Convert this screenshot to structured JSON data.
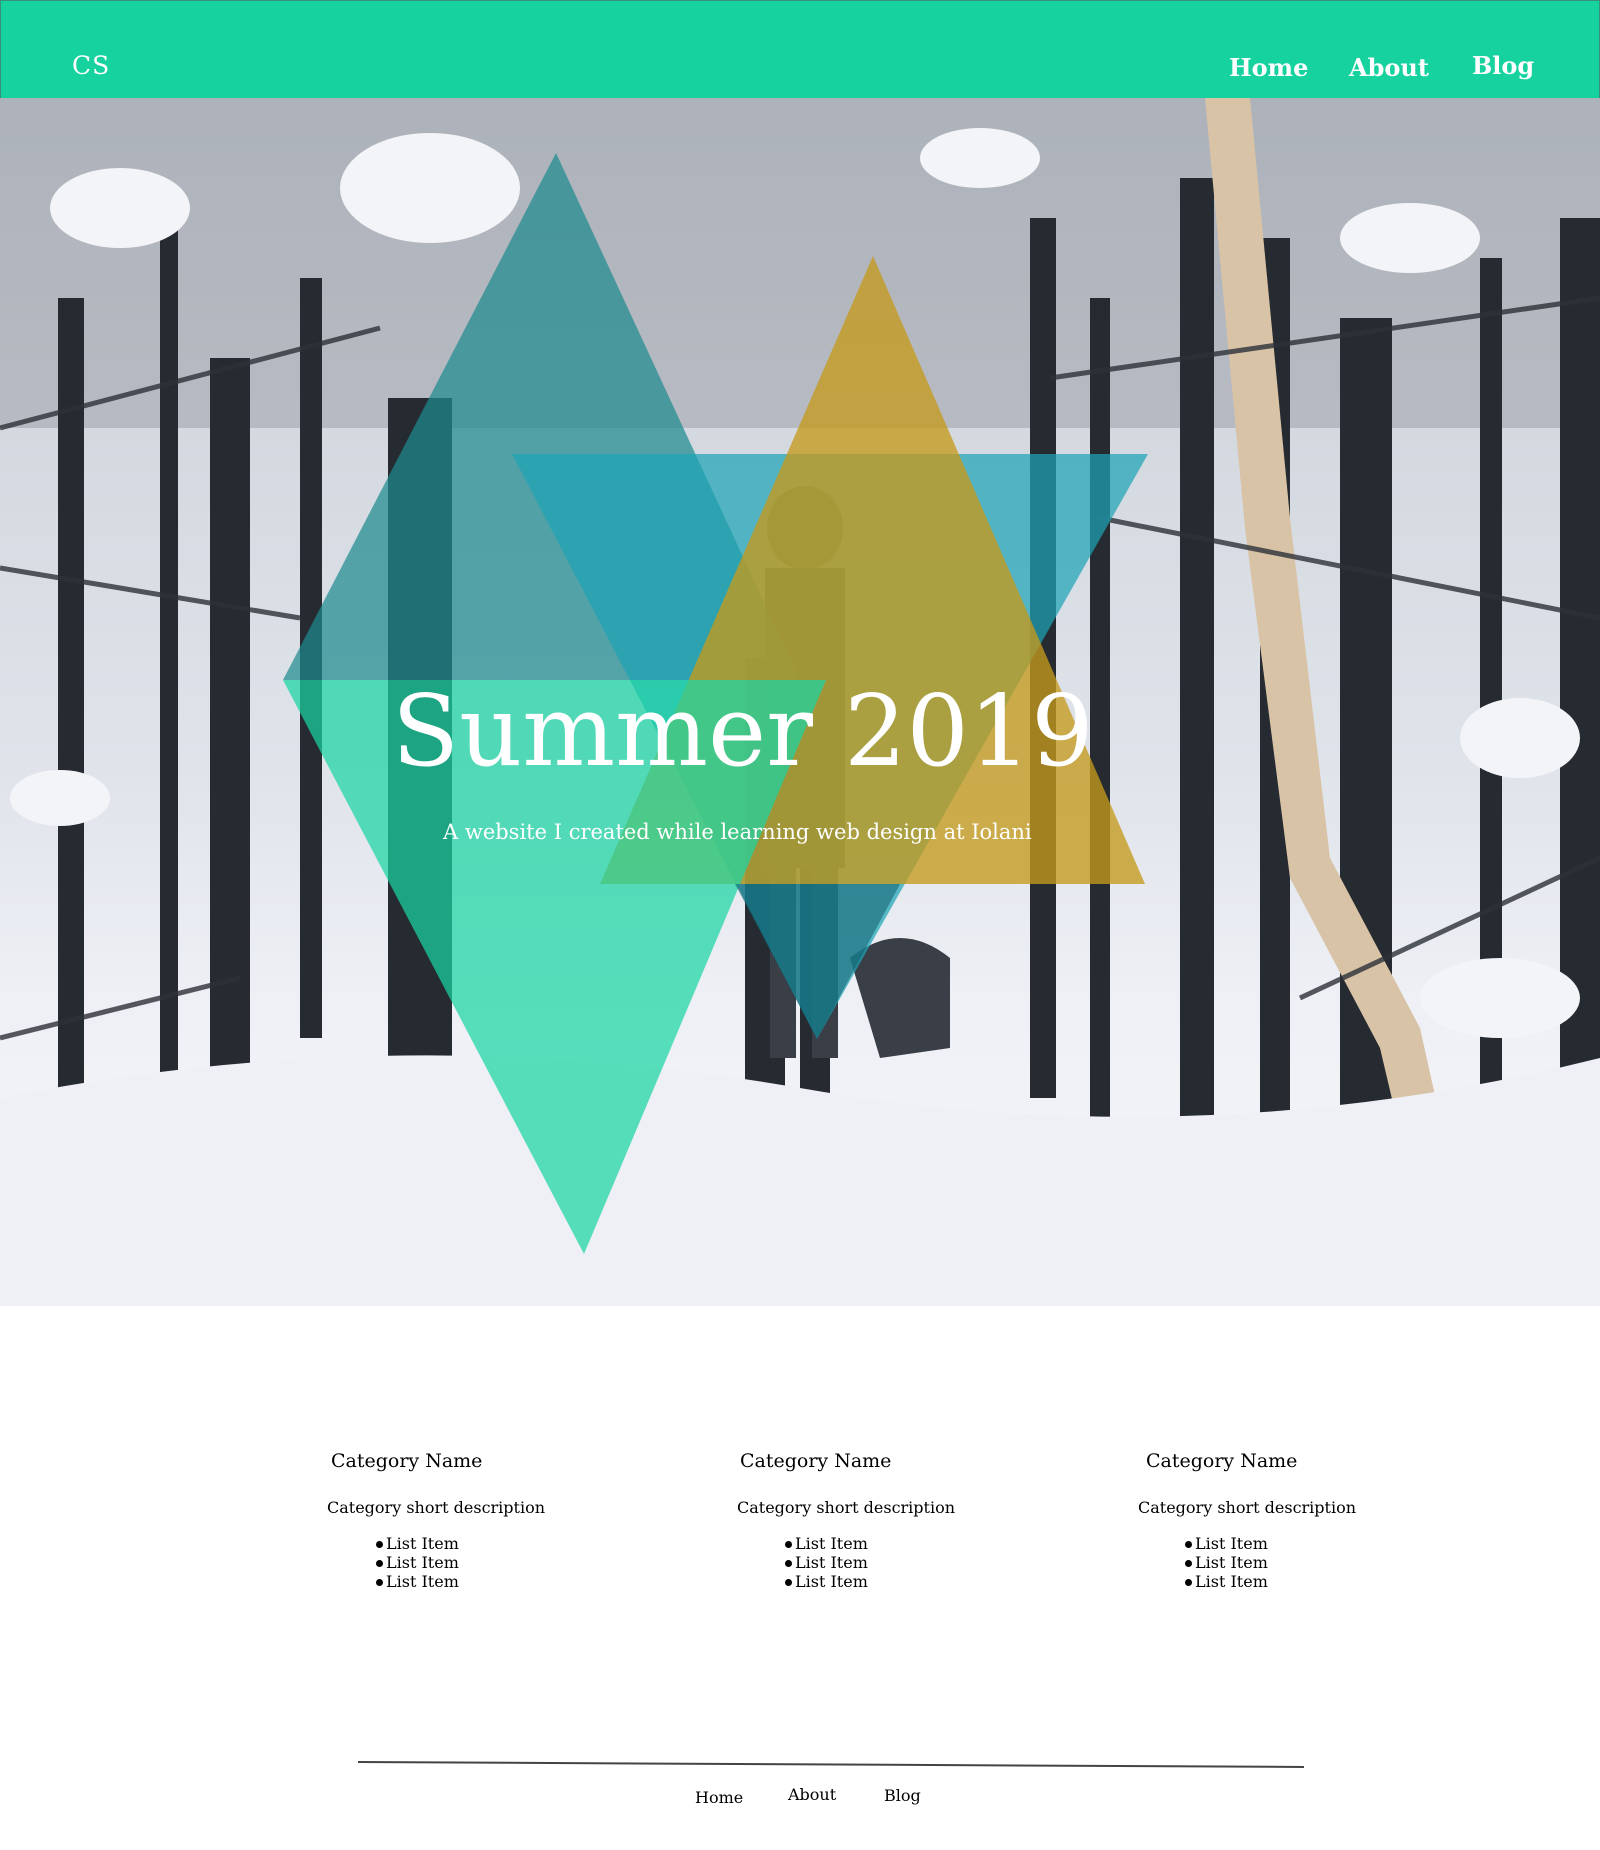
{
  "navbar": {
    "logo": "CS",
    "links": [
      "Home",
      "About",
      "Blog"
    ],
    "background_color": "#16d29f"
  },
  "hero": {
    "title": "Summer 2019",
    "subtitle": "A website I created while learning web design at Iolani",
    "background_image": "snowy-forest-photo",
    "overlay_colors": {
      "teal_dark": "#2a8c96",
      "teal_blue": "#1fa6b8",
      "mustard": "#c9a02a",
      "green": "#19d4a4",
      "deep_teal": "#156d7a"
    }
  },
  "categories": [
    {
      "name": "Category Name",
      "description": "Category short description",
      "items": [
        "List Item",
        "List Item",
        "List Item"
      ]
    },
    {
      "name": "Category Name",
      "description": "Category short description",
      "items": [
        "List Item",
        "List Item",
        "List Item"
      ]
    },
    {
      "name": "Category Name",
      "description": "Category short description",
      "items": [
        "List Item",
        "List Item",
        "List Item"
      ]
    }
  ],
  "footer": {
    "links": [
      "Home",
      "About",
      "Blog"
    ]
  }
}
